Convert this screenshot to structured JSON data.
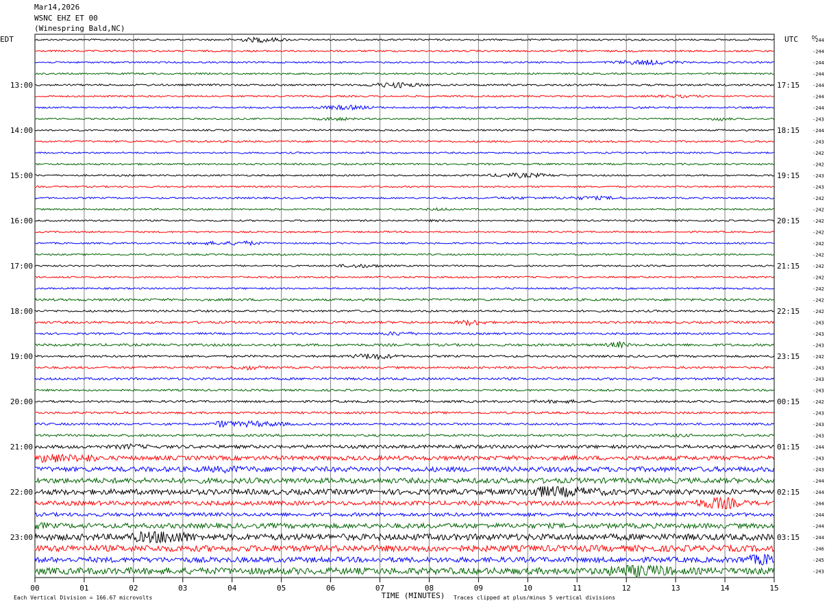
{
  "header": {
    "date": "Mar14,2026",
    "station": "WSNC EHZ ET 00",
    "location": "(Winespring Bald,NC)"
  },
  "chart_data": {
    "type": "line",
    "left_zone_label": "EDT",
    "right_zone_label": "UTC",
    "dc_header": "DC",
    "xlabel": "TIME (MINUTES)",
    "x_ticks": [
      "00",
      "01",
      "02",
      "03",
      "04",
      "05",
      "06",
      "07",
      "08",
      "09",
      "10",
      "11",
      "12",
      "13",
      "14",
      "15"
    ],
    "xlim": [
      0,
      15
    ],
    "left_hour_labels": [
      "13:00",
      "14:00",
      "15:00",
      "16:00",
      "17:00",
      "18:00",
      "19:00",
      "20:00",
      "21:00",
      "22:00",
      "23:00"
    ],
    "right_hour_labels": [
      "17:15",
      "18:15",
      "19:15",
      "20:15",
      "21:15",
      "22:15",
      "23:15",
      "00:15",
      "01:15",
      "02:15",
      "03:15"
    ],
    "trace_colors": [
      "#000000",
      "#ff0000",
      "#0000ff",
      "#006400"
    ],
    "dc_values": [
      "-244",
      "-244",
      "-244",
      "-244",
      "-244",
      "-244",
      "-244",
      "-243",
      "-244",
      "-243",
      "-242",
      "-242",
      "-243",
      "-243",
      "-242",
      "-242",
      "-242",
      "-242",
      "-242",
      "-242",
      "-242",
      "-242",
      "-242",
      "-242",
      "-242",
      "-243",
      "-243",
      "-243",
      "-242",
      "-243",
      "-243",
      "-243",
      "-242",
      "-243",
      "-243",
      "-243",
      "-244",
      "-243",
      "-243",
      "-244",
      "-244",
      "-244",
      "-244",
      "-244",
      "-244",
      "-246",
      "-245",
      "-243"
    ],
    "trace_amplitude": [
      1.0,
      1.1,
      1.0,
      1.0,
      1.1,
      1.0,
      1.0,
      1.0,
      1.0,
      1.1,
      1.0,
      1.1,
      1.0,
      1.0,
      1.0,
      1.0,
      1.0,
      1.0,
      1.0,
      1.0,
      1.0,
      1.1,
      1.0,
      1.4,
      1.2,
      1.4,
      1.2,
      1.5,
      1.3,
      1.3,
      1.4,
      1.2,
      1.3,
      1.3,
      1.3,
      1.4,
      2.0,
      2.6,
      3.0,
      3.2,
      3.3,
      2.6,
      2.2,
      3.0,
      3.8,
      3.8,
      3.2,
      4.0
    ],
    "footer_left": "Each Vertical Division =  166.67 microvolts",
    "footer_right": "Traces clipped at plus/minus 5 vertical divisions"
  }
}
